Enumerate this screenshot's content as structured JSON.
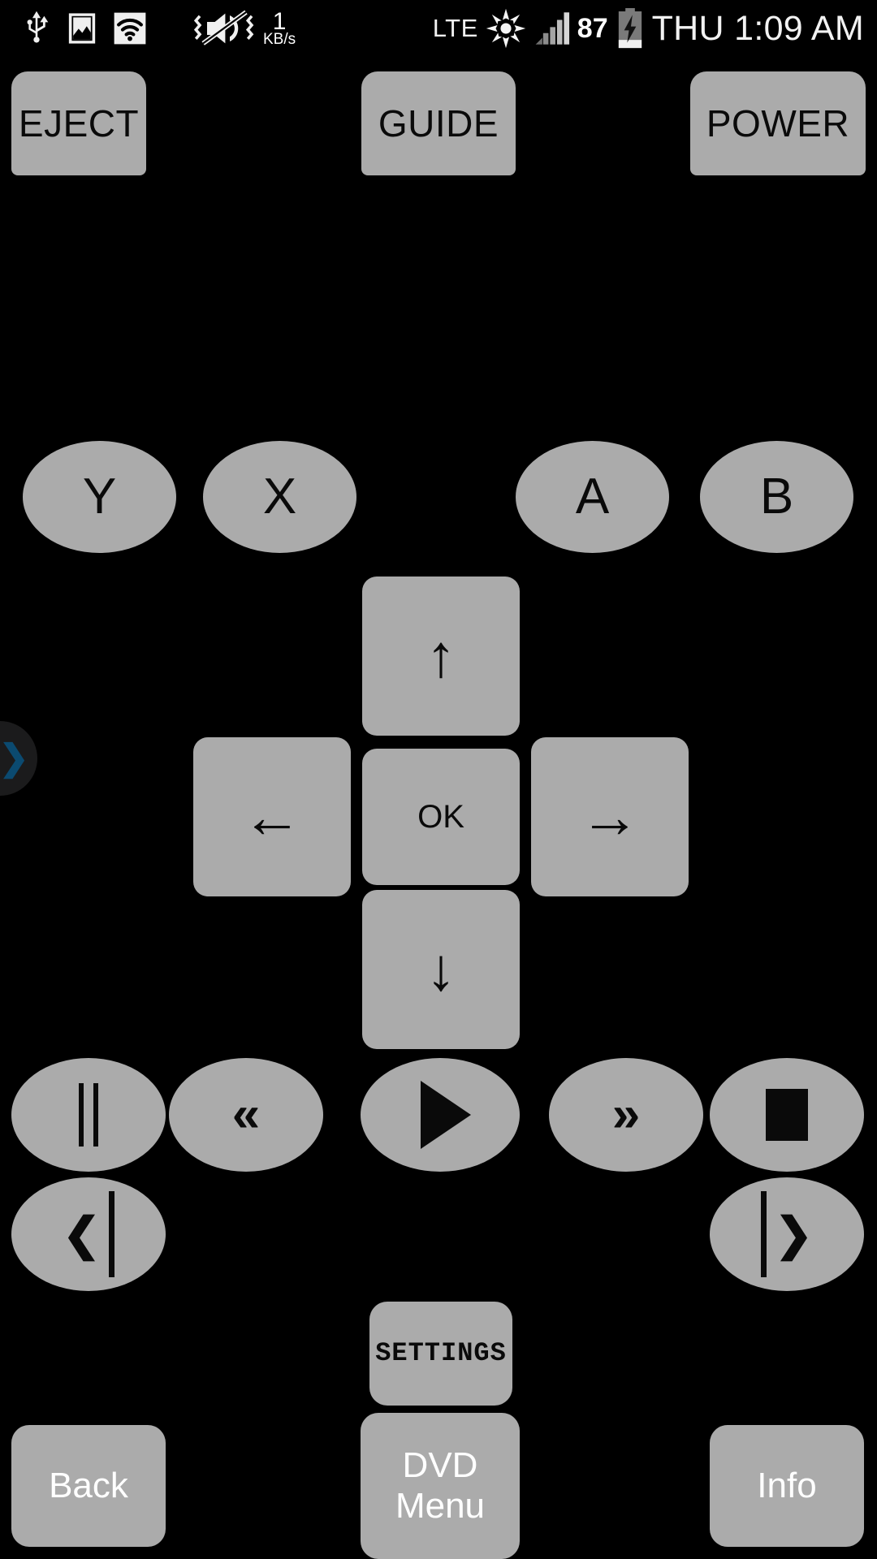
{
  "status_bar": {
    "icons": [
      "usb-icon",
      "screenshot-image-icon",
      "wifi-icon",
      "vibrate-mute-icon"
    ],
    "net_speed_value": "1",
    "net_speed_unit": "KB/s",
    "network_type": "LTE",
    "brightness_icon": "sun-brightness-icon",
    "signal_icon": "signal-bars-icon",
    "battery_percent": "87",
    "battery_icon": "battery-charging-icon",
    "clock": "THU 1:09 AM"
  },
  "drawer": {
    "name": "edge-drawer-handle",
    "glyph": "❯",
    "color": "#0b4a70"
  },
  "colors": {
    "background": "#000000",
    "button_face": "#ababab",
    "button_text": "#0a0a0a",
    "label_white": "#ffffff"
  },
  "remote": {
    "top_row": [
      {
        "name": "eject-button",
        "label": "EJECT"
      },
      {
        "name": "guide-button",
        "label": "GUIDE"
      },
      {
        "name": "power-button",
        "label": "POWER"
      }
    ],
    "face_buttons": [
      {
        "name": "y-button",
        "label": "Y"
      },
      {
        "name": "x-button",
        "label": "X"
      },
      {
        "name": "a-button",
        "label": "A"
      },
      {
        "name": "b-button",
        "label": "B"
      }
    ],
    "dpad": {
      "up": {
        "name": "dpad-up-button",
        "label": "↑"
      },
      "left": {
        "name": "dpad-left-button",
        "label": "←"
      },
      "ok": {
        "name": "dpad-ok-button",
        "label": "OK"
      },
      "right": {
        "name": "dpad-right-button",
        "label": "→"
      },
      "down": {
        "name": "dpad-down-button",
        "label": "↓"
      }
    },
    "media_row": [
      {
        "name": "pause-button",
        "label": "❙❙",
        "icon": "pause-icon"
      },
      {
        "name": "rewind-button",
        "label": "«",
        "icon": "rewind-icon"
      },
      {
        "name": "play-button",
        "label": "▶",
        "icon": "play-icon"
      },
      {
        "name": "fast-forward-button",
        "label": "»",
        "icon": "fast-forward-icon"
      },
      {
        "name": "stop-button",
        "label": "■",
        "icon": "stop-icon"
      }
    ],
    "skip_row": [
      {
        "name": "previous-track-button",
        "label": "❮",
        "icon": "skip-previous-icon"
      },
      {
        "name": "next-track-button",
        "label": "❯",
        "icon": "skip-next-icon"
      }
    ],
    "settings_button": {
      "name": "settings-button",
      "label": "SETTINGS"
    },
    "bottom_row": [
      {
        "name": "back-button",
        "label": "Back"
      },
      {
        "name": "dvd-menu-button",
        "label_line1": "DVD",
        "label_line2": "Menu"
      },
      {
        "name": "info-button",
        "label": "Info"
      }
    ]
  }
}
